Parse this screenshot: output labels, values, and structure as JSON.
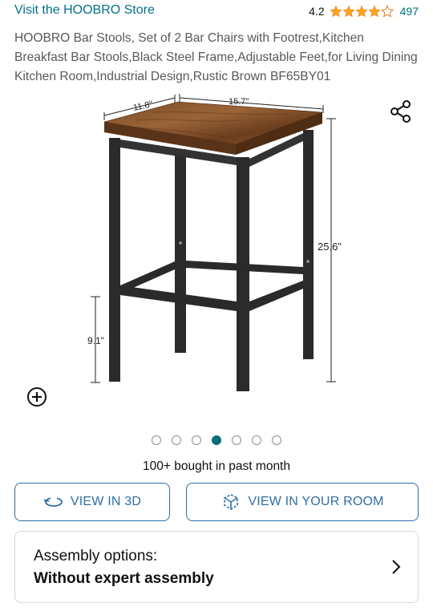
{
  "header": {
    "store_link": "Visit the HOOBRO Store",
    "rating_score": "4.2",
    "rating_value": 4.2,
    "rating_count": "497",
    "star_color": "#ffa41c"
  },
  "product": {
    "title": "HOOBRO Bar Stools, Set of 2 Bar Chairs with Footrest,Kitchen Breakfast Bar Stools,Black Steel Frame,Adjustable Feet,for Living Dining Kitchen Room,Industrial Design,Rustic Brown BF65BY01"
  },
  "image": {
    "dim_depth": "11.8\"",
    "dim_width": "15.7\"",
    "dim_height": "25.6\"",
    "dim_footrest": "9.1\"",
    "icon_share": "share-icon",
    "icon_zoom": "zoom-plus-icon"
  },
  "carousel": {
    "total": 7,
    "active_index": 3,
    "active_color": "#0b6e7f"
  },
  "social_proof": {
    "bought_text": "100+ bought in past month"
  },
  "buttons": {
    "view_3d": "VIEW IN 3D",
    "view_room": "VIEW IN YOUR ROOM",
    "accent_color": "#2f6ea8"
  },
  "assembly": {
    "label": "Assembly options:",
    "value": "Without expert assembly"
  }
}
